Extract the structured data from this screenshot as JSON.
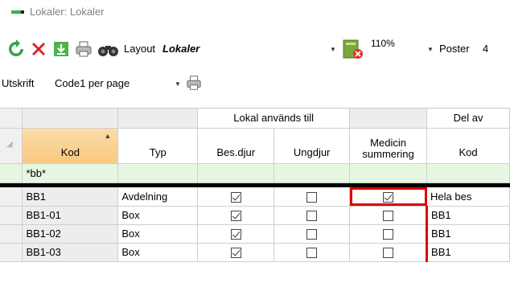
{
  "window": {
    "title": "Lokaler: Lokaler"
  },
  "toolbar": {
    "layout_label": "Layout",
    "layout_value": "Lokaler",
    "zoom_value": "110%",
    "records_label": "Poster",
    "records_value": "4",
    "print_label": "Utskrift",
    "print_value": "Code1 per page"
  },
  "grid": {
    "group_headers": {
      "lokal_anvands_till": "Lokal används till",
      "del_av": "Del av"
    },
    "columns": {
      "kod": "Kod",
      "typ": "Typ",
      "bes_djur": "Bes.djur",
      "ungdjur": "Ungdjur",
      "medicin_summering": "Medicin summering",
      "del_av_kod": "Kod"
    },
    "filter": {
      "kod": "*bb*"
    },
    "rows": [
      {
        "kod": "BB1",
        "typ": "Avdelning",
        "bes_djur": true,
        "ungdjur": false,
        "medicin": true,
        "del_av_kod": "Hela bes"
      },
      {
        "kod": "BB1-01",
        "typ": "Box",
        "bes_djur": true,
        "ungdjur": false,
        "medicin": false,
        "del_av_kod": "BB1"
      },
      {
        "kod": "BB1-02",
        "typ": "Box",
        "bes_djur": true,
        "ungdjur": false,
        "medicin": false,
        "del_av_kod": "BB1"
      },
      {
        "kod": "BB1-03",
        "typ": "Box",
        "bes_djur": true,
        "ungdjur": false,
        "medicin": false,
        "del_av_kod": "BB1"
      }
    ]
  },
  "colors": {
    "sorted_header": "#f8c880",
    "filter_row": "#e5f7e0",
    "highlight": "#e00000",
    "logo_green": "#2db34a"
  }
}
